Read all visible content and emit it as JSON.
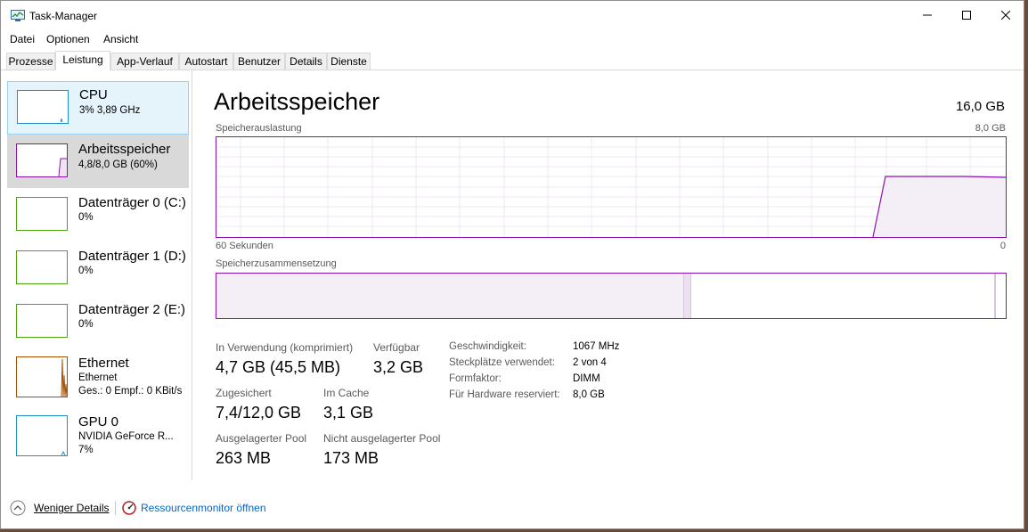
{
  "window": {
    "title": "Task-Manager"
  },
  "menu": [
    "Datei",
    "Optionen",
    "Ansicht"
  ],
  "tabs": [
    "Prozesse",
    "Leistung",
    "App-Verlauf",
    "Autostart",
    "Benutzer",
    "Details",
    "Dienste"
  ],
  "active_tab": "Leistung",
  "sidebar": [
    {
      "name": "CPU",
      "sub": "3% 3,89 GHz",
      "color": "#1e90c8",
      "state": "hover"
    },
    {
      "name": "Arbeitsspeicher",
      "sub": "4,8/8,0 GB (60%)",
      "color": "#8b12ae",
      "state": "selected"
    },
    {
      "name": "Datenträger 0 (C:)",
      "sub": "0%",
      "color": "#4da60c"
    },
    {
      "name": "Datenträger 1 (D:)",
      "sub": "0%",
      "color": "#4da60c"
    },
    {
      "name": "Datenträger 2 (E:)",
      "sub": "0%",
      "color": "#4da60c"
    },
    {
      "name": "Ethernet",
      "sub": "Ethernet",
      "sub2": "Ges.: 0 Empf.: 0 KBit/s",
      "color": "#a74f01"
    },
    {
      "name": "GPU 0",
      "sub": "NVIDIA GeForce R...",
      "sub2": "7%",
      "color": "#1e90c8"
    }
  ],
  "main": {
    "title": "Arbeitsspeicher",
    "total": "16,0 GB",
    "graph_label": "Speicherauslastung",
    "graph_max": "8,0 GB",
    "graph_time_left": "60 Sekunden",
    "graph_time_right": "0",
    "composition_label": "Speicherzusammensetzung"
  },
  "stats": {
    "in_use_label": "In Verwendung (komprimiert)",
    "in_use_value": "4,7 GB (45,5 MB)",
    "available_label": "Verfügbar",
    "available_value": "3,2 GB",
    "committed_label": "Zugesichert",
    "committed_value": "7,4/12,0 GB",
    "cached_label": "Im Cache",
    "cached_value": "3,1 GB",
    "paged_label": "Ausgelagerter Pool",
    "paged_value": "263 MB",
    "nonpaged_label": "Nicht ausgelagerter Pool",
    "nonpaged_value": "173 MB"
  },
  "details": {
    "speed_label": "Geschwindigkeit:",
    "speed_value": "1067 MHz",
    "slots_label": "Steckplätze verwendet:",
    "slots_value": "2 von 4",
    "form_label": "Formfaktor:",
    "form_value": "DIMM",
    "reserved_label": "Für Hardware reserviert:",
    "reserved_value": "8,0 GB"
  },
  "footer": {
    "fewer_details": "Weniger Details",
    "resource_monitor": "Ressourcenmonitor öffnen"
  },
  "colors": {
    "memory": "#8b12ae",
    "link": "#0066cc"
  }
}
